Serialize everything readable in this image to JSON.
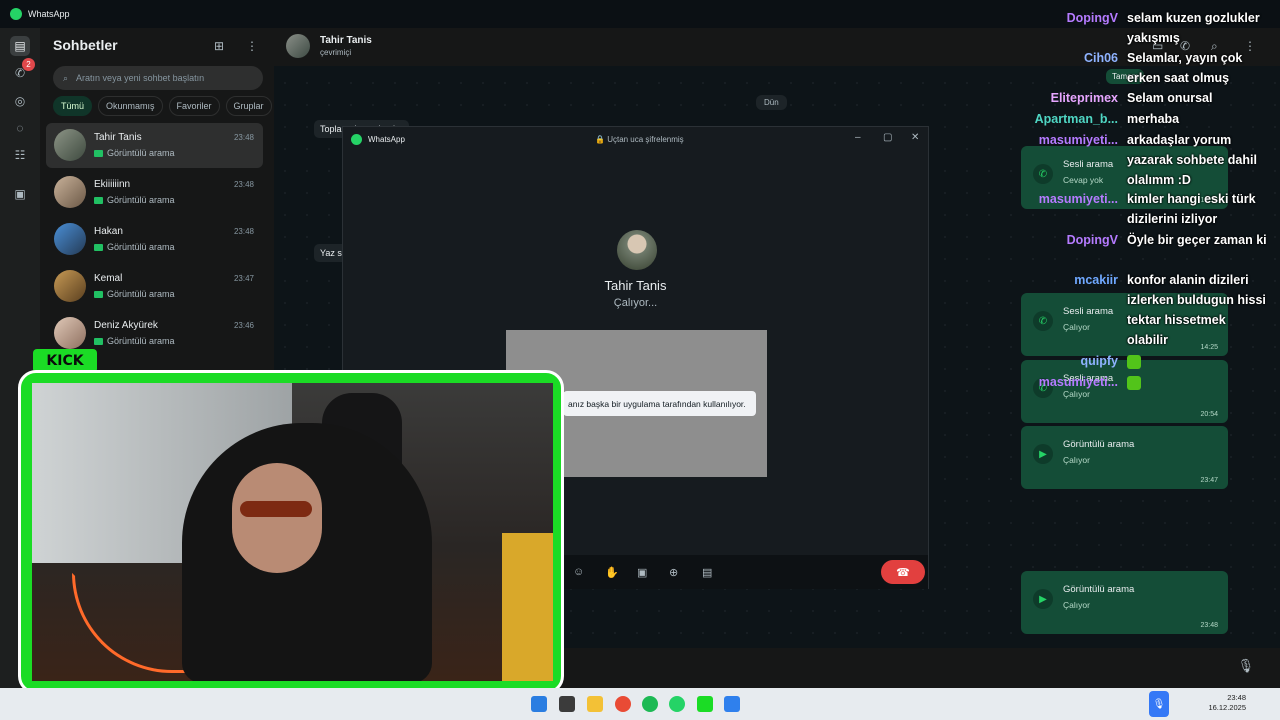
{
  "app": {
    "title": "WhatsApp"
  },
  "sidebar": {
    "missed_calls_badge": "2"
  },
  "chatlist": {
    "title": "Sohbetler",
    "search_placeholder": "Aratın veya yeni sohbet başlatın",
    "filters": [
      "Tümü",
      "Okunmamış",
      "Favoriler",
      "Gruplar"
    ],
    "chats": [
      {
        "name": "Tahir Tanis",
        "time": "23:48",
        "preview": "Görüntülü arama"
      },
      {
        "name": "Ekiiiiiinn",
        "time": "23:48",
        "preview": "Görüntülü arama"
      },
      {
        "name": "Hakan",
        "time": "23:48",
        "preview": "Görüntülü arama"
      },
      {
        "name": "Kemal",
        "time": "23:47",
        "preview": "Görüntülü arama"
      },
      {
        "name": "Deniz Akyürek",
        "time": "23:46",
        "preview": "Görüntülü arama"
      }
    ]
  },
  "conversation": {
    "contact_name": "Tahir Tanis",
    "contact_status": "çevrimiçi",
    "date_divider": "Dün",
    "snippet_1": "Toplantıdayım başka",
    "snippet_2": "Yaz s",
    "reply_snippet": "Tamam",
    "calls": [
      {
        "title": "Sesli arama",
        "status": "Cevap yok",
        "time": "16:13"
      },
      {
        "title": "Sesli arama",
        "status": "Çalıyor",
        "time": "14:25"
      },
      {
        "title": "Sesli arama",
        "status": "Çalıyor",
        "time": "20:54"
      },
      {
        "title": "Görüntülü arama",
        "status": "Çalıyor",
        "time": "23:47"
      },
      {
        "title": "Görüntülü arama",
        "status": "Çalıyor",
        "time": "23:48"
      }
    ]
  },
  "call_window": {
    "app_label": "WhatsApp",
    "encryption": "Uçtan uca şifrelenmiş",
    "callee_name": "Tahir Tanis",
    "call_status": "Çalıyor...",
    "camera_notice": "anız başka bir uygulama tarafından kullanılıyor."
  },
  "stream_chat": [
    {
      "user": "DopingV",
      "text": "selam kuzen gozlukler yakışmış",
      "color": "#b57bff"
    },
    {
      "user": "Cih06",
      "text": "Selamlar, yayın çok erken saat olmuş",
      "color": "#8fb3ff"
    },
    {
      "user": "Eliteprimex",
      "text": "Selam onursal",
      "color": "#e7a6ff"
    },
    {
      "user": "Apartman_b...",
      "text": "merhaba",
      "color": "#4fd6c3"
    },
    {
      "user": "masumiyeti...",
      "text": "arkadaşlar yorum yazarak sohbete dahil olalımm :D",
      "color": "#b57bff"
    },
    {
      "user": "masumiyeti...",
      "text": "kimler hangi eski türk dizilerini izliyor",
      "color": "#b57bff"
    },
    {
      "user": "DopingV",
      "text": "Öyle bir geçer zaman ki",
      "color": "#b57bff"
    },
    {
      "user": "mcakiir",
      "text": "konfor alanin dizileri izlerken buldugun hissi tektar hissetmek olabilir",
      "color": "#6fa8ff"
    },
    {
      "user": "quipfy",
      "text": "",
      "color": "#8fb3ff"
    },
    {
      "user": "masumiyeti...",
      "text": "",
      "color": "#b57bff"
    }
  ],
  "stream_overlay": {
    "brand": "KICK"
  },
  "taskbar": {
    "time": "23:48",
    "date": "16.12.2025"
  }
}
